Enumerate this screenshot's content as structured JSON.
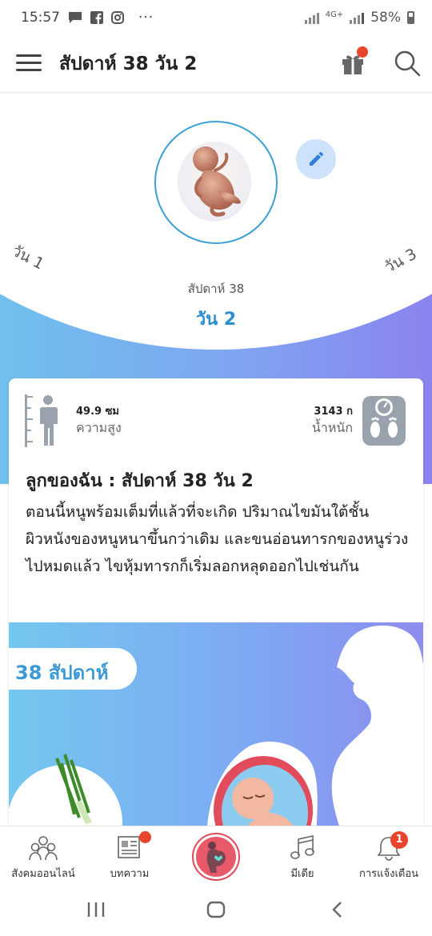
{
  "status_bar": {
    "time": "15:57",
    "ellipsis": "···",
    "network": "4G+",
    "battery": "58%"
  },
  "app_bar": {
    "title": "สัปดาห์ 38 วัน 2"
  },
  "hero": {
    "prev_day": "วัน 1",
    "next_day": "วัน 3",
    "week_label": "สัปดาห์ 38",
    "day_label": "วัน 2"
  },
  "stats": {
    "height_value": "49.9 ซม",
    "height_label": "ความสูง",
    "weight_value": "3143 ก",
    "weight_label": "น้ำหนัก"
  },
  "card": {
    "title": "ลูกของฉัน : สัปดาห์ 38 วัน 2",
    "body": "ตอนนี้หนูพร้อมเต็มที่แล้วที่จะเกิด ปริมาณไขมันใต้ชั้นผิวหนังของหนูหนาขึ้นกว่าเดิม และขนอ่อนทารกของหนูร่วงไปหมดแล้ว ไขหุ้มทารกก็เริ่มลอกหลุดออกไปเช่นกัน"
  },
  "illustration": {
    "week_badge": "38 สัปดาห์"
  },
  "bottom_nav": {
    "items": [
      {
        "label": "สังคมออนไลน์",
        "icon": "community-icon"
      },
      {
        "label": "บทความ",
        "icon": "article-icon"
      },
      {
        "label": "",
        "icon": "pregnancy-icon"
      },
      {
        "label": "มีเดีย",
        "icon": "music-icon"
      },
      {
        "label": "การแจ้งเตือน",
        "icon": "bell-icon"
      }
    ],
    "notification_count": "1"
  },
  "colors": {
    "accent": "#2d8fd0",
    "badge": "#e8452c",
    "center_button": "#e85a6a"
  }
}
